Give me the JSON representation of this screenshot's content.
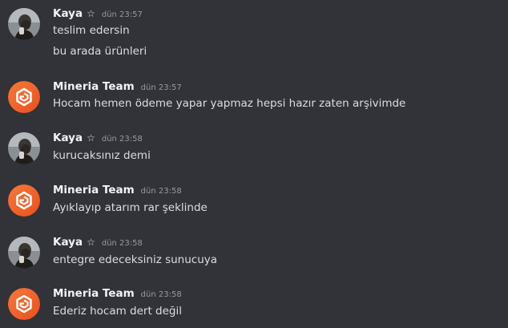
{
  "messages": [
    {
      "author": "Kaya",
      "badge": "☆",
      "timestamp": "dün 23:57",
      "avatar": "user-photo-avatar",
      "lines": [
        "teslim edersin",
        "bu arada ürünleri"
      ]
    },
    {
      "author": "Mineria Team",
      "timestamp": "dün 23:57",
      "avatar": "mineria-logo-avatar",
      "lines": [
        "Hocam hemen ödeme yapar yapmaz hepsi hazır zaten arşivimde"
      ]
    },
    {
      "author": "Kaya",
      "badge": "☆",
      "timestamp": "dün 23:58",
      "avatar": "user-photo-avatar",
      "lines": [
        "kurucaksınız demi"
      ]
    },
    {
      "author": "Mineria Team",
      "timestamp": "dün 23:58",
      "avatar": "mineria-logo-avatar",
      "lines": [
        "Ayıklayıp atarım rar şeklinde"
      ]
    },
    {
      "author": "Kaya",
      "badge": "☆",
      "timestamp": "dün 23:58",
      "avatar": "user-photo-avatar",
      "lines": [
        "entegre edeceksiniz sunucuya"
      ]
    },
    {
      "author": "Mineria Team",
      "timestamp": "dün 23:58",
      "avatar": "mineria-logo-avatar",
      "lines": [
        "Ederiz hocam dert değil"
      ]
    }
  ],
  "colors": {
    "background": "#313338",
    "username": "#f2f3f5",
    "message_text": "#dbdee1",
    "timestamp": "#949ba4",
    "brand_orange": "#f2692b"
  }
}
